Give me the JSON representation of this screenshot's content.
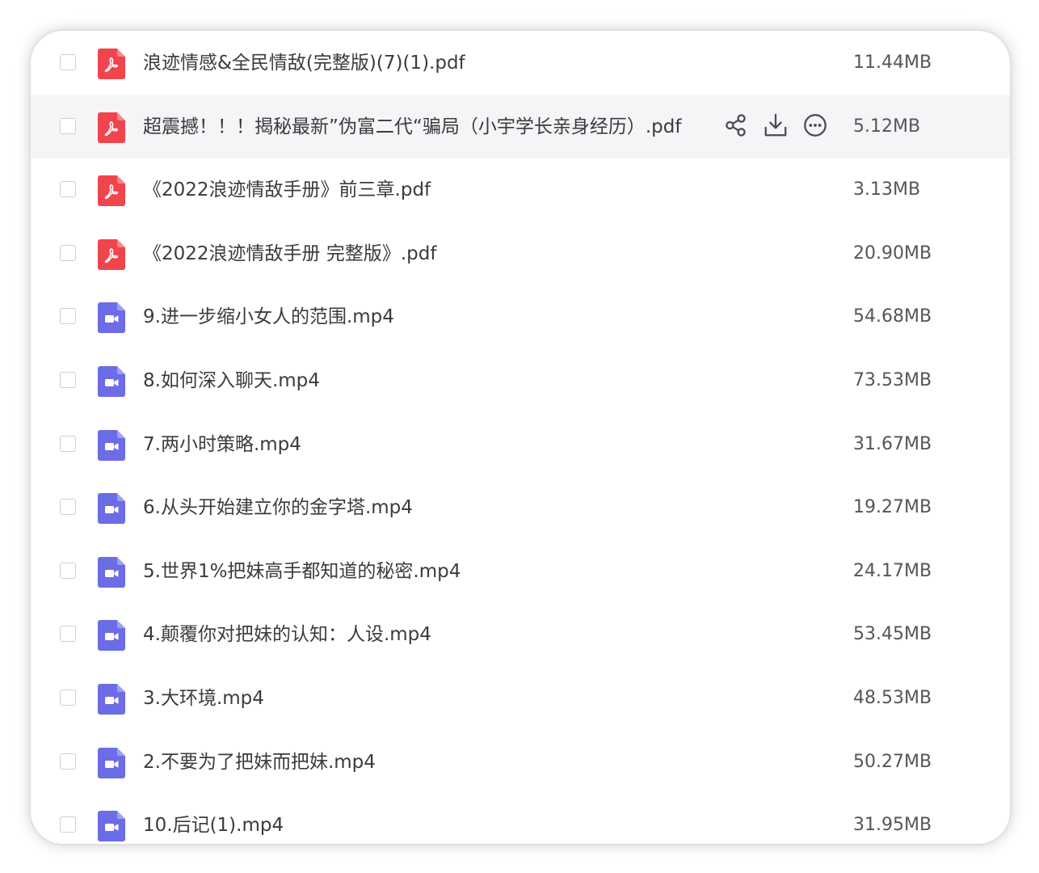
{
  "colors": {
    "pdf_icon": "#f0454c",
    "video_icon": "#6b6ce6",
    "hover_row": "#f5f5f7",
    "text": "#3b3b3f",
    "size_text": "#55555a"
  },
  "hover_actions": [
    {
      "name": "share",
      "icon": "share-icon"
    },
    {
      "name": "download",
      "icon": "download-icon"
    },
    {
      "name": "more",
      "icon": "more-icon"
    }
  ],
  "files": [
    {
      "name": "浪迹情感&全民情敌(完整版)(7)(1).pdf",
      "size": "11.44MB",
      "type": "pdf",
      "icon": "pdf-file-icon",
      "hovered": false
    },
    {
      "name": "超震撼！！！揭秘最新”伪富二代“骗局（小宇学长亲身经历）.pdf",
      "size": "5.12MB",
      "type": "pdf",
      "icon": "pdf-file-icon",
      "hovered": true
    },
    {
      "name": "《2022浪迹情敌手册》前三章.pdf",
      "size": "3.13MB",
      "type": "pdf",
      "icon": "pdf-file-icon",
      "hovered": false
    },
    {
      "name": "《2022浪迹情敌手册 完整版》.pdf",
      "size": "20.90MB",
      "type": "pdf",
      "icon": "pdf-file-icon",
      "hovered": false
    },
    {
      "name": "9.进一步缩小女人的范围.mp4",
      "size": "54.68MB",
      "type": "video",
      "icon": "video-file-icon",
      "hovered": false
    },
    {
      "name": "8.如何深入聊天.mp4",
      "size": "73.53MB",
      "type": "video",
      "icon": "video-file-icon",
      "hovered": false
    },
    {
      "name": "7.两小时策略.mp4",
      "size": "31.67MB",
      "type": "video",
      "icon": "video-file-icon",
      "hovered": false
    },
    {
      "name": "6.从头开始建立你的金字塔.mp4",
      "size": "19.27MB",
      "type": "video",
      "icon": "video-file-icon",
      "hovered": false
    },
    {
      "name": "5.世界1%把妹高手都知道的秘密.mp4",
      "size": "24.17MB",
      "type": "video",
      "icon": "video-file-icon",
      "hovered": false
    },
    {
      "name": "4.颠覆你对把妹的认知：人设.mp4",
      "size": "53.45MB",
      "type": "video",
      "icon": "video-file-icon",
      "hovered": false
    },
    {
      "name": "3.大环境.mp4",
      "size": "48.53MB",
      "type": "video",
      "icon": "video-file-icon",
      "hovered": false
    },
    {
      "name": "2.不要为了把妹而把妹.mp4",
      "size": "50.27MB",
      "type": "video",
      "icon": "video-file-icon",
      "hovered": false
    },
    {
      "name": "10.后记(1).mp4",
      "size": "31.95MB",
      "type": "video",
      "icon": "video-file-icon",
      "hovered": false
    }
  ]
}
